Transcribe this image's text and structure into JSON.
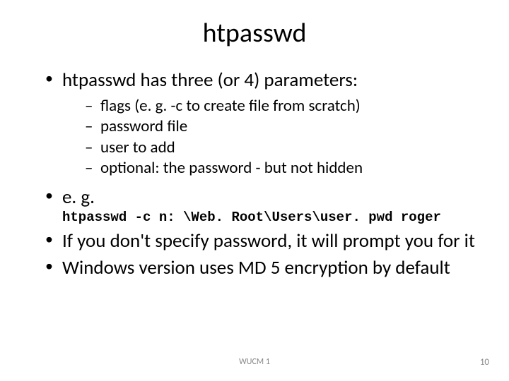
{
  "title": "htpasswd",
  "bullets": [
    {
      "text": "htpasswd has three (or 4) parameters:",
      "sub": [
        "flags (e. g. -c to create file from scratch)",
        "password file",
        "user to add",
        "optional: the password - but not hidden"
      ]
    },
    {
      "text": "e. g.",
      "code": "htpasswd -c n: \\Web. Root\\Users\\user. pwd roger"
    },
    {
      "text": "If you don't specify password, it will prompt you for it"
    },
    {
      "text": "Windows version uses MD 5 encryption by default"
    }
  ],
  "footer": {
    "label": "WUCM 1",
    "page": "10"
  }
}
